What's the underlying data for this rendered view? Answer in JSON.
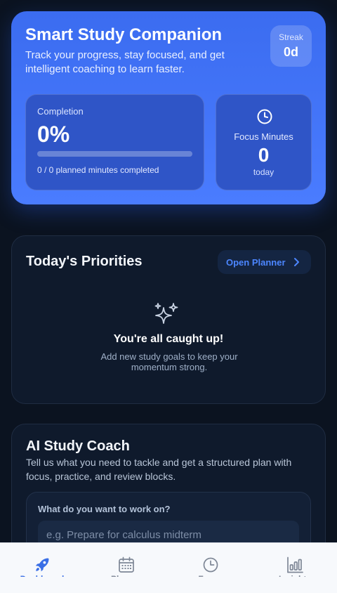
{
  "hero": {
    "title": "Smart Study Companion",
    "subtitle": "Track your progress, stay focused, and get intelligent coaching to learn faster.",
    "streak": {
      "label": "Streak",
      "value": "0d"
    },
    "completion": {
      "label": "Completion",
      "value": "0%",
      "progress_fraction": 0,
      "footnote": "0 / 0 planned minutes completed"
    },
    "focus": {
      "icon": "clock-icon",
      "label": "Focus Minutes",
      "value": "0",
      "footnote": "today"
    }
  },
  "priorities": {
    "title": "Today's Priorities",
    "open_planner_label": "Open Planner",
    "empty_icon": "sparkles-icon",
    "empty_title": "You're all caught up!",
    "empty_subtitle": "Add new study goals to keep your momentum strong."
  },
  "coach": {
    "title": "AI Study Coach",
    "subtitle": "Tell us what you need to tackle and get a structured plan with focus, practice, and review blocks.",
    "question": "What do you want to work on?",
    "input_placeholder": "e.g. Prepare for calculus midterm",
    "input_value": ""
  },
  "nav": {
    "items": [
      {
        "label": "Dashboard",
        "icon": "rocket-icon",
        "active": true
      },
      {
        "label": "Planner",
        "icon": "calendar-icon",
        "active": false
      },
      {
        "label": "Focus",
        "icon": "clock-icon",
        "active": false
      },
      {
        "label": "Insights",
        "icon": "bar-chart-icon",
        "active": false
      }
    ]
  },
  "colors": {
    "background": "#0b1320",
    "hero_gradient_start": "#3b6cf0",
    "hero_gradient_end": "#4a7cff",
    "accent": "#4c86ff",
    "nav_active": "#3a6fe6"
  }
}
